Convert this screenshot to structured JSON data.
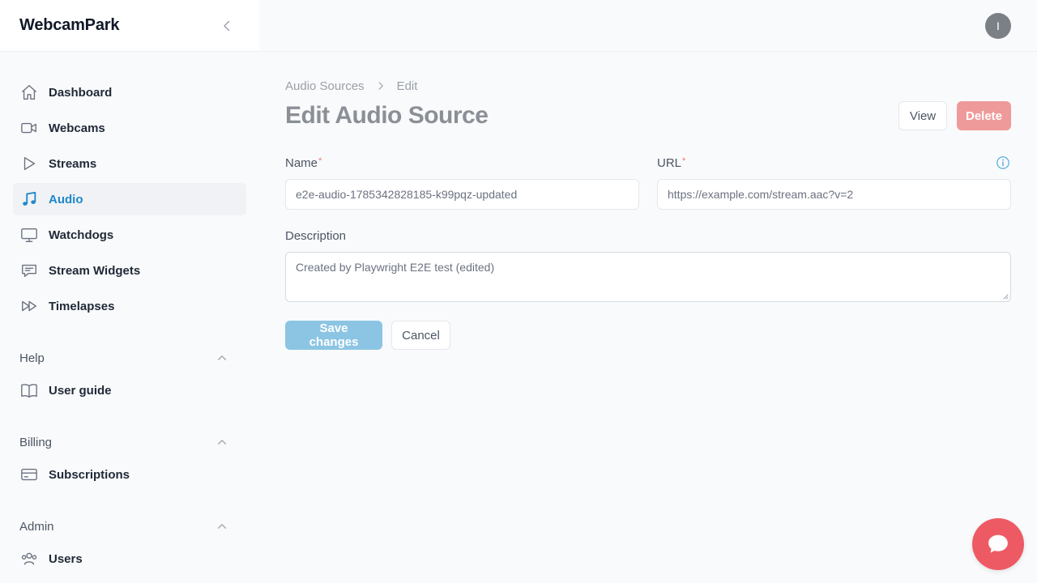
{
  "brand": {
    "name": "WebcamPark"
  },
  "user": {
    "avatar_initial": "I"
  },
  "nav": {
    "items": [
      {
        "label": "Dashboard",
        "icon": "home-icon"
      },
      {
        "label": "Webcams",
        "icon": "video-camera-icon"
      },
      {
        "label": "Streams",
        "icon": "play-icon"
      },
      {
        "label": "Audio",
        "icon": "music-note-icon",
        "active": true
      },
      {
        "label": "Watchdogs",
        "icon": "monitor-icon"
      },
      {
        "label": "Stream Widgets",
        "icon": "chat-bubble-icon"
      },
      {
        "label": "Timelapses",
        "icon": "fast-forward-icon"
      }
    ],
    "sections": [
      {
        "title": "Help",
        "items": [
          {
            "label": "User guide",
            "icon": "book-icon"
          }
        ]
      },
      {
        "title": "Billing",
        "items": [
          {
            "label": "Subscriptions",
            "icon": "credit-card-icon"
          }
        ]
      },
      {
        "title": "Admin",
        "items": [
          {
            "label": "Users",
            "icon": "users-icon"
          }
        ]
      }
    ]
  },
  "breadcrumb": {
    "parent": "Audio Sources",
    "current": "Edit"
  },
  "page": {
    "title": "Edit Audio Source"
  },
  "actions": {
    "view_label": "View",
    "delete_label": "Delete"
  },
  "form": {
    "name_label": "Name",
    "name_value": "e2e-audio-1785342828185-k99pqz-updated",
    "url_label": "URL",
    "url_value": "https://example.com/stream.aac?v=2",
    "required_mark": "*",
    "description_label": "Description",
    "description_value": "Created by Playwright E2E test (edited)",
    "save_label": "Save changes",
    "cancel_label": "Cancel"
  },
  "colors": {
    "accent": "#1e88c8",
    "delete": "#ef9a9a",
    "save": "#8cc5e3",
    "chat_fab": "#ee5a64",
    "avatar": "#7b7f86"
  }
}
